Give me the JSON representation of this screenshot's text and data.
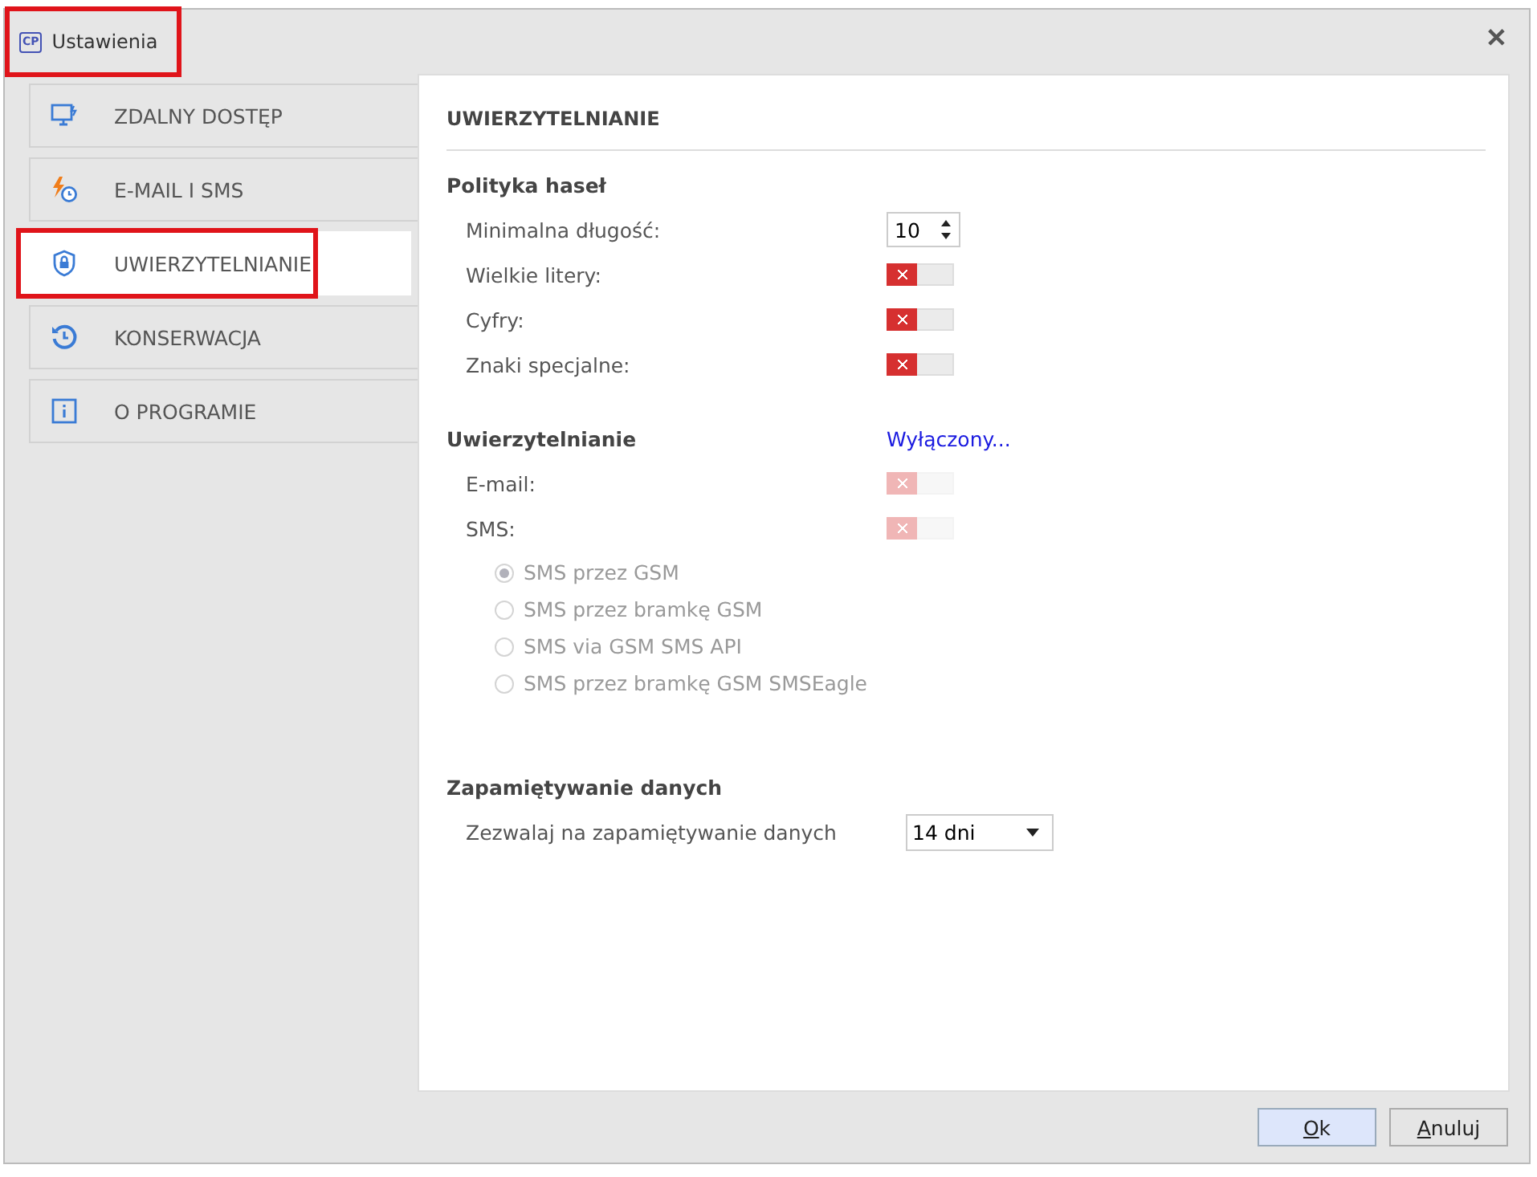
{
  "window": {
    "title": "Ustawienia",
    "app_icon": "CP",
    "annotated": true,
    "close": "✕"
  },
  "sidebar": {
    "items": [
      {
        "label": "ZDALNY DOSTĘP",
        "selected": false,
        "annotated": false
      },
      {
        "label": "E-MAIL I SMS",
        "selected": false,
        "annotated": false
      },
      {
        "label": "UWIERZYTELNIANIE",
        "selected": true,
        "annotated": true
      },
      {
        "label": "KONSERWACJA",
        "selected": false,
        "annotated": false
      },
      {
        "label": "O PROGRAMIE",
        "selected": false,
        "annotated": false
      }
    ]
  },
  "panel": {
    "title": "UWIERZYTELNIANIE",
    "password_policy": {
      "heading": "Polityka haseł",
      "min_length": {
        "label": "Minimalna długość:",
        "value": "10"
      },
      "toggles": [
        {
          "label": "Wielkie litery:",
          "on": false,
          "disabled": false
        },
        {
          "label": "Cyfry:",
          "on": false,
          "disabled": false
        },
        {
          "label": "Znaki specjalne:",
          "on": false,
          "disabled": false
        }
      ]
    },
    "authentication": {
      "heading": "Uwierzytelnianie",
      "status_link": "Wyłączony...",
      "toggles": [
        {
          "label": "E-mail:",
          "on": false,
          "disabled": true
        },
        {
          "label": "SMS:",
          "on": false,
          "disabled": true
        }
      ],
      "sms_options": [
        {
          "label": "SMS przez GSM",
          "selected": true,
          "disabled": true
        },
        {
          "label": "SMS przez bramkę GSM",
          "selected": false,
          "disabled": true
        },
        {
          "label": "SMS via GSM SMS API",
          "selected": false,
          "disabled": true
        },
        {
          "label": "SMS przez bramkę GSM SMSEagle",
          "selected": false,
          "disabled": true
        }
      ]
    },
    "data_retention": {
      "heading": "Zapamiętywanie danych",
      "label": "Zezwalaj na zapamiętywanie danych",
      "value": "14 dni"
    }
  },
  "buttons": [
    {
      "label": "Ok",
      "default": true
    },
    {
      "label": "Anuluj",
      "default": false
    }
  ]
}
